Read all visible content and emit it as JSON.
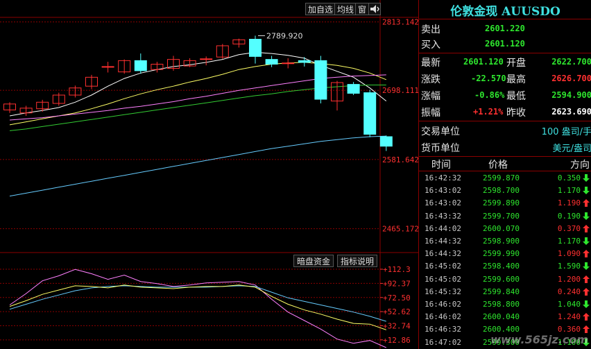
{
  "toolbar": {
    "add_watchlist": "加自选",
    "moving_avg": "均线",
    "window": "窗",
    "sound_icon": "speaker-icon"
  },
  "indicator_toolbar": {
    "dark_pool": "暗盘资金",
    "help": "指标说明"
  },
  "chart_data": [
    {
      "type": "candlestick",
      "title": "",
      "y_ticks": [
        "2813.142",
        "2698.111",
        "2581.642",
        "2465.172"
      ],
      "y_tick_values": [
        2813.142,
        2698.111,
        2581.642,
        2465.172
      ],
      "ylim": [
        2425,
        2850
      ],
      "annotation": "2789.920",
      "annotation_value": 2789.92,
      "candles": [
        {
          "o": 2665,
          "c": 2675,
          "h": 2678,
          "l": 2660
        },
        {
          "o": 2660,
          "c": 2668,
          "h": 2672,
          "l": 2655
        },
        {
          "o": 2667,
          "c": 2678,
          "h": 2682,
          "l": 2662
        },
        {
          "o": 2676,
          "c": 2690,
          "h": 2694,
          "l": 2672
        },
        {
          "o": 2690,
          "c": 2702,
          "h": 2706,
          "l": 2686
        },
        {
          "o": 2705,
          "c": 2720,
          "h": 2724,
          "l": 2700
        },
        {
          "o": 2738,
          "c": 2738,
          "h": 2746,
          "l": 2728
        },
        {
          "o": 2729,
          "c": 2748,
          "h": 2750,
          "l": 2726
        },
        {
          "o": 2748,
          "c": 2731,
          "h": 2760,
          "l": 2726
        },
        {
          "o": 2733,
          "c": 2742,
          "h": 2746,
          "l": 2728
        },
        {
          "o": 2735,
          "c": 2750,
          "h": 2756,
          "l": 2731
        },
        {
          "o": 2739,
          "c": 2748,
          "h": 2752,
          "l": 2737
        },
        {
          "o": 2750,
          "c": 2751,
          "h": 2755,
          "l": 2740
        },
        {
          "o": 2754,
          "c": 2773,
          "h": 2776,
          "l": 2751
        },
        {
          "o": 2776,
          "c": 2783,
          "h": 2785,
          "l": 2770
        },
        {
          "o": 2784,
          "c": 2755,
          "h": 2790,
          "l": 2743
        },
        {
          "o": 2750,
          "c": 2742,
          "h": 2756,
          "l": 2737
        },
        {
          "o": 2744,
          "c": 2744,
          "h": 2752,
          "l": 2735
        },
        {
          "o": 2748,
          "c": 2745,
          "h": 2754,
          "l": 2738
        },
        {
          "o": 2748,
          "c": 2683,
          "h": 2756,
          "l": 2676
        },
        {
          "o": 2680,
          "c": 2711,
          "h": 2714,
          "l": 2664
        },
        {
          "o": 2708,
          "c": 2693,
          "h": 2712,
          "l": 2690
        },
        {
          "o": 2694,
          "c": 2624,
          "h": 2699,
          "l": 2619
        },
        {
          "o": 2620,
          "c": 2604,
          "h": 2622,
          "l": 2596
        }
      ],
      "ma_series": [
        {
          "color": "#ffffff",
          "values": [
            2655,
            2660,
            2664,
            2669,
            2678,
            2690,
            2705,
            2718,
            2727,
            2733,
            2738,
            2741,
            2745,
            2750,
            2758,
            2762,
            2760,
            2757,
            2752,
            2740,
            2730,
            2720,
            2702,
            2680
          ]
        },
        {
          "color": "#ffff66",
          "values": [
            2640,
            2645,
            2650,
            2655,
            2660,
            2667,
            2675,
            2684,
            2692,
            2699,
            2705,
            2712,
            2718,
            2725,
            2733,
            2738,
            2742,
            2744,
            2745,
            2743,
            2740,
            2735,
            2727,
            2716
          ]
        },
        {
          "color": "#ff80ff",
          "values": [
            2648,
            2650,
            2652,
            2655,
            2658,
            2661,
            2664,
            2668,
            2671,
            2675,
            2679,
            2684,
            2688,
            2693,
            2698,
            2702,
            2706,
            2710,
            2714,
            2718,
            2720,
            2722,
            2723,
            2724
          ]
        },
        {
          "color": "#33cc33",
          "values": [
            2630,
            2633,
            2637,
            2641,
            2645,
            2649,
            2653,
            2657,
            2661,
            2665,
            2669,
            2673,
            2677,
            2681,
            2685,
            2689,
            2692,
            2696,
            2699,
            2702,
            2704,
            2706,
            2707,
            2707
          ]
        },
        {
          "color": "#66ccff",
          "values": [
            2520,
            2525,
            2530,
            2535,
            2540,
            2545,
            2550,
            2555,
            2560,
            2565,
            2570,
            2575,
            2580,
            2585,
            2590,
            2595,
            2600,
            2604,
            2608,
            2612,
            2615,
            2618,
            2620,
            2621
          ]
        }
      ]
    },
    {
      "type": "line",
      "title": "",
      "y_ticks": [
        "+112.3",
        "+92.37",
        "+72.50",
        "+52.62",
        "+32.74",
        "+12.86"
      ],
      "y_tick_values": [
        112.3,
        92.37,
        72.5,
        52.62,
        32.74,
        12.86
      ],
      "ylim": [
        0,
        125
      ],
      "series": [
        {
          "color": "#ff80ff",
          "values": [
            62,
            78,
            96,
            103,
            112,
            106,
            98,
            104,
            95,
            92,
            88,
            90,
            93,
            94,
            95,
            90,
            70,
            52,
            40,
            28,
            14,
            8,
            12,
            2
          ]
        },
        {
          "color": "#66ccff",
          "values": [
            56,
            63,
            70,
            76,
            82,
            86,
            88,
            89,
            88,
            87,
            87,
            87,
            87,
            88,
            89,
            88,
            80,
            72,
            67,
            62,
            57,
            52,
            46,
            39
          ]
        },
        {
          "color": "#ffff66",
          "values": [
            60,
            68,
            77,
            83,
            89,
            88,
            86,
            90,
            87,
            86,
            85,
            87,
            88,
            88,
            90,
            87,
            74,
            63,
            55,
            49,
            42,
            36,
            35,
            27
          ]
        }
      ]
    }
  ],
  "quote": {
    "title": "伦敦金现 AUUSDO",
    "sell_label": "卖出",
    "sell": "2601.220",
    "buy_label": "买入",
    "buy": "2601.120",
    "latest_label": "最新",
    "latest": "2601.120",
    "open_label": "开盘",
    "open": "2622.700",
    "change_label": "涨跌",
    "change": "-22.570",
    "high_label": "最高",
    "high": "2626.700",
    "pct_label": "涨幅",
    "pct": "-0.86%",
    "low_label": "最低",
    "low": "2594.900",
    "amp_label": "振幅",
    "amp": "+1.21%",
    "prev_label": "昨收",
    "prev": "2623.690",
    "unit_label": "交易单位",
    "unit": "100 盎司/手",
    "currency_label": "货币单位",
    "currency": "美元/盎司",
    "col_time": "时间",
    "col_price": "价格",
    "col_dir": "方向",
    "colors": {
      "up": "#ff3030",
      "down": "#2ee62e",
      "title": "#3fe0e0"
    }
  },
  "ticks": [
    {
      "time": "16:42:32",
      "price": "2599.870",
      "delta": "0.350",
      "dir": "down"
    },
    {
      "time": "16:43:02",
      "price": "2598.700",
      "delta": "1.170",
      "dir": "down"
    },
    {
      "time": "16:43:02",
      "price": "2599.890",
      "delta": "1.190",
      "dir": "up"
    },
    {
      "time": "16:43:32",
      "price": "2599.700",
      "delta": "0.190",
      "dir": "down"
    },
    {
      "time": "16:44:02",
      "price": "2600.070",
      "delta": "0.370",
      "dir": "up"
    },
    {
      "time": "16:44:32",
      "price": "2598.900",
      "delta": "1.170",
      "dir": "down"
    },
    {
      "time": "16:44:32",
      "price": "2599.990",
      "delta": "1.090",
      "dir": "up"
    },
    {
      "time": "16:45:02",
      "price": "2598.400",
      "delta": "1.590",
      "dir": "down"
    },
    {
      "time": "16:45:02",
      "price": "2599.600",
      "delta": "1.200",
      "dir": "up"
    },
    {
      "time": "16:45:32",
      "price": "2599.840",
      "delta": "0.240",
      "dir": "up"
    },
    {
      "time": "16:46:02",
      "price": "2598.800",
      "delta": "1.040",
      "dir": "down"
    },
    {
      "time": "16:46:02",
      "price": "2600.040",
      "delta": "1.240",
      "dir": "up"
    },
    {
      "time": "16:46:32",
      "price": "2600.400",
      "delta": "0.360",
      "dir": "up"
    },
    {
      "time": "16:47:02",
      "price": "2599.300",
      "delta": "1.100",
      "dir": "down"
    }
  ],
  "watermark": "www.565jz.com"
}
